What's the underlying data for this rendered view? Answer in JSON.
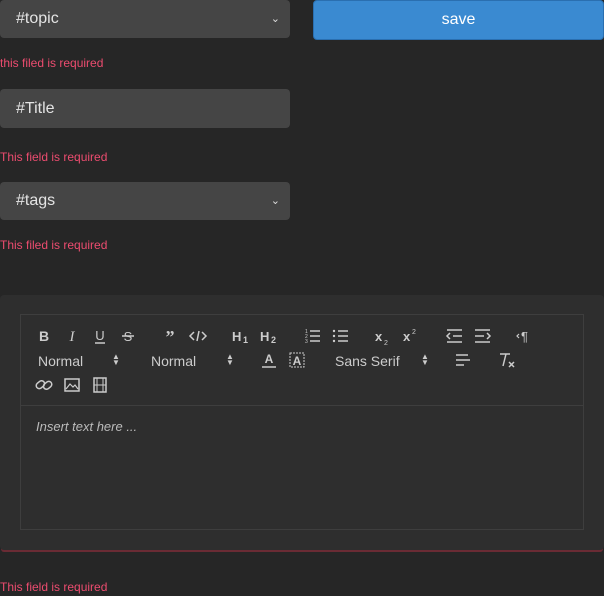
{
  "form": {
    "topic": {
      "value": "#topic",
      "error": "this filed is required"
    },
    "title": {
      "value": "#Title",
      "error": "This field is required"
    },
    "tags": {
      "value": "#tags",
      "error": "This filed is required"
    },
    "editor_error": "This field is required"
  },
  "save_button": {
    "label": "save"
  },
  "editor": {
    "header_select": "Normal",
    "size_select": "Normal",
    "font_select": "Sans Serif",
    "placeholder": "Insert text here ..."
  },
  "colors": {
    "background": "#262626",
    "field_bg": "#454545",
    "error": "#ec4c6f",
    "save_bg": "#3a8ad1",
    "card_bg": "#2e2e2e"
  },
  "icons": {
    "toolbar_row1": [
      "bold-icon",
      "italic-icon",
      "underline-icon",
      "strike-icon",
      "blockquote-icon",
      "code-block-icon",
      "h1-icon",
      "h2-icon",
      "ordered-list-icon",
      "bullet-list-icon",
      "subscript-icon",
      "superscript-icon",
      "outdent-icon",
      "indent-icon",
      "rtl-icon"
    ],
    "toolbar_row2": [
      "text-color-icon",
      "background-color-icon",
      "align-left-icon",
      "clear-format-icon"
    ],
    "toolbar_row3": [
      "link-icon",
      "image-icon",
      "video-icon"
    ]
  }
}
